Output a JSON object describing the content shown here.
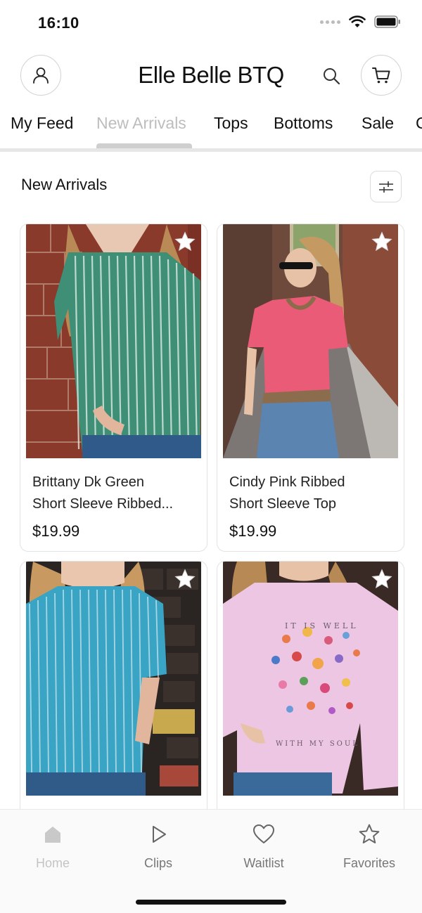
{
  "status_bar": {
    "time": "16:10"
  },
  "header": {
    "title": "Elle Belle BTQ"
  },
  "tabs": [
    {
      "label": "My Feed"
    },
    {
      "label": "New Arrivals"
    },
    {
      "label": "Tops"
    },
    {
      "label": "Bottoms"
    },
    {
      "label": "Sale"
    },
    {
      "label": "C"
    }
  ],
  "active_tab": "New Arrivals",
  "section": {
    "title": "New Arrivals"
  },
  "products": [
    {
      "name_line1": "Brittany Dk Green",
      "name_line2": "Short Sleeve Ribbed...",
      "price": "$19.99"
    },
    {
      "name_line1": "Cindy Pink Ribbed",
      "name_line2": "Short Sleeve Top",
      "price": "$19.99"
    },
    {
      "name_line1": "",
      "name_line2": "",
      "price": ""
    },
    {
      "name_line1": "",
      "name_line2": "",
      "price": ""
    }
  ],
  "sweatshirt_print": {
    "top": "IT IS WELL",
    "bottom": "WITH MY SOUL"
  },
  "bottom_nav": [
    {
      "label": "Home",
      "icon": "home-icon"
    },
    {
      "label": "Clips",
      "icon": "play-icon"
    },
    {
      "label": "Waitlist",
      "icon": "heart-icon"
    },
    {
      "label": "Favorites",
      "icon": "star-icon"
    }
  ],
  "colors": {
    "accent_inactive": "#bdbdbd",
    "border": "#e3e3e3",
    "nav_bg": "#fafafa"
  }
}
